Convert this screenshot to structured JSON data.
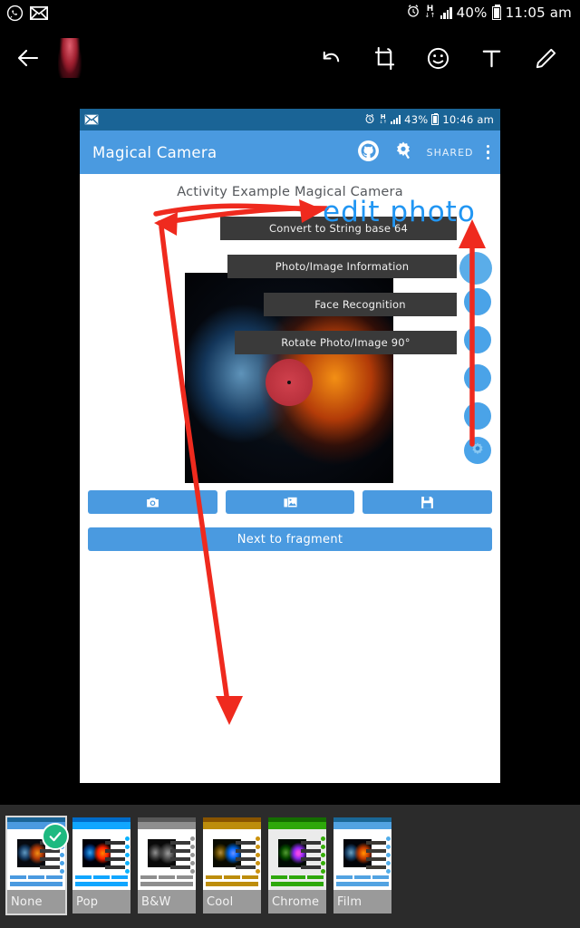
{
  "device_status_bar": {
    "icons": [
      "whatsapp-icon",
      "envelope-icon"
    ],
    "alarm_icon": "alarm-icon",
    "network_type": "H",
    "signal_icon": "signal-bars-icon",
    "battery_percent": "40%",
    "time": "11:05 am"
  },
  "editor_toolbar": {
    "back_label": "back-arrow",
    "thumbnail_label": "photo-thumbnail",
    "tools": [
      {
        "name": "undo-icon",
        "label": "Undo"
      },
      {
        "name": "crop-icon",
        "label": "Crop"
      },
      {
        "name": "sticker-icon",
        "label": "Sticker"
      },
      {
        "name": "text-icon",
        "label": "T"
      },
      {
        "name": "draw-icon",
        "label": "Draw"
      }
    ]
  },
  "screenshot": {
    "inner_status_bar": {
      "envelope_icon": "envelope-icon",
      "alarm_icon": "alarm-icon",
      "network_type": "H",
      "battery_percent": "43%",
      "time": "10:46 am"
    },
    "app_bar": {
      "title": "Magical Camera",
      "github_icon": "github-icon",
      "settings_icon": "gear-icon",
      "shared_label": "SHARED",
      "overflow_icon": "overflow-menu-icon"
    },
    "activity_title": "Activity Example Magical Camera",
    "photo_alt": "vinyl-record-water-and-fire",
    "option_buttons": [
      "Convert to String base 64",
      "Photo/Image Information",
      "Face Recognition",
      "Rotate Photo/Image 90°"
    ],
    "fab_gear_icon": "gear-icon",
    "action_buttons": [
      {
        "name": "camera-button",
        "icon": "camera-icon"
      },
      {
        "name": "gallery-button",
        "icon": "gallery-icon"
      },
      {
        "name": "save-button",
        "icon": "save-icon"
      }
    ],
    "next_button_label": "Next to fragment"
  },
  "annotations": {
    "edit_photo_text": "edit photo",
    "ink_color": "#2196f3",
    "arrow_color": "#ef2a1e",
    "arrows": [
      "arrow-to-edit-photo-label",
      "arrow-down-left-long",
      "arrow-up-to-fab"
    ]
  },
  "filter_strip": {
    "selected": "None",
    "check_badge": "check-icon",
    "items": [
      {
        "label": "None",
        "style": "none",
        "selected": true
      },
      {
        "label": "Pop",
        "style": "pop",
        "selected": false
      },
      {
        "label": "B&W",
        "style": "gray",
        "selected": false
      },
      {
        "label": "Cool",
        "style": "cool",
        "selected": false
      },
      {
        "label": "Chrome",
        "style": "chrome",
        "selected": false
      },
      {
        "label": "Film",
        "style": "film",
        "selected": false
      }
    ]
  },
  "colors": {
    "app_bar_blue": "#4a9ae0",
    "status_blue": "#1a6496",
    "ink_blue": "#2196f3",
    "arrow_red": "#ef2a1e",
    "check_green": "#1eb980",
    "strip_bg": "#2b2b2b"
  }
}
